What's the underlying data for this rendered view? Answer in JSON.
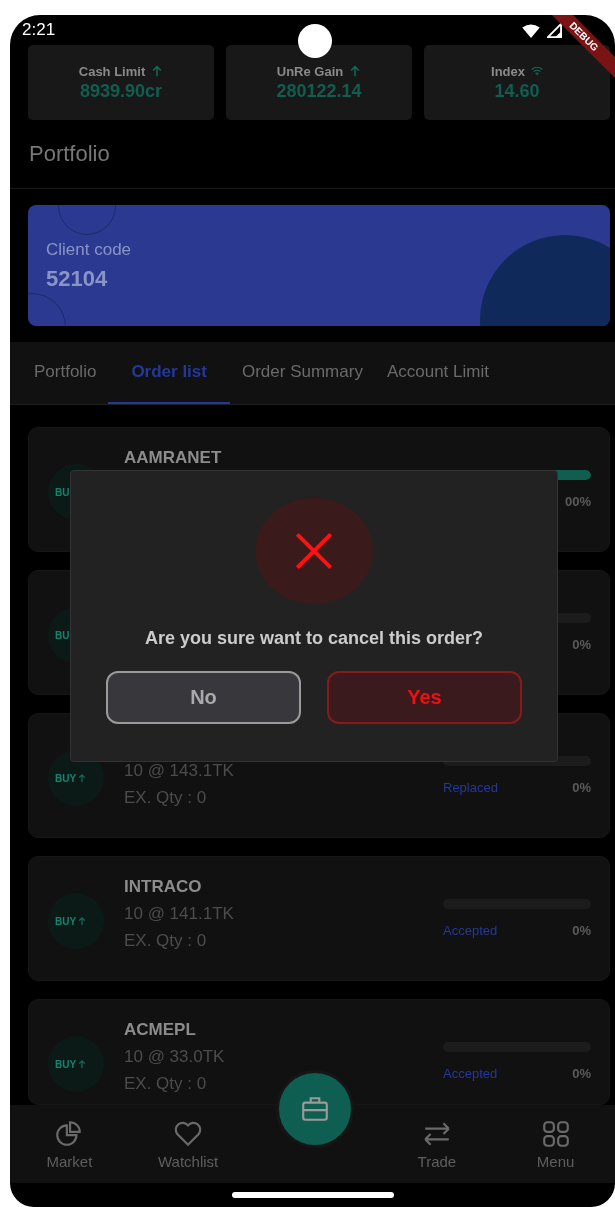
{
  "status_bar": {
    "time": "2:21",
    "ribbon": "DEBUG"
  },
  "stats": [
    {
      "label": "Cash Limit",
      "kind": "arrow",
      "value": "8939.90cr"
    },
    {
      "label": "UnRe Gain",
      "kind": "arrow",
      "value": "280122.14"
    },
    {
      "label": "Index",
      "kind": "wifi",
      "value": "14.60"
    }
  ],
  "title": "Portfolio",
  "client": {
    "label": "Client code",
    "code": "52104"
  },
  "tabs": [
    {
      "label": "Portfolio",
      "selected": false
    },
    {
      "label": "Order list",
      "selected": true
    },
    {
      "label": "Order Summary",
      "selected": false
    },
    {
      "label": "Account Limit",
      "selected": false
    }
  ],
  "orders": [
    {
      "badge": "BU",
      "name": "AAMRANET",
      "level": 1,
      "percent": "00%"
    },
    {
      "badge": "BU",
      "level": 0,
      "percent": "0%"
    },
    {
      "badge": "BUY",
      "arrow": true,
      "price": "10 @ 143.1TK",
      "qty": "EX. Qty : 0",
      "level": 0,
      "status": "Replaced",
      "percent": "0%"
    },
    {
      "badge": "BUY",
      "arrow": true,
      "name": "INTRACO",
      "price": "10 @ 141.1TK",
      "qty": "EX. Qty : 0",
      "level": 0,
      "status": "Accepted",
      "percent": "0%"
    },
    {
      "badge": "BUY",
      "arrow": true,
      "name": "ACMEPL",
      "price": "10 @ 33.0TK",
      "qty": "EX. Qty : 0",
      "level": 0,
      "status": "Accepted",
      "percent": "0%"
    }
  ],
  "dialog": {
    "message": "Are you sure want to cancel this order?",
    "buttons": [
      {
        "label": "No",
        "kind": "neutral"
      },
      {
        "label": "Yes",
        "kind": "danger"
      }
    ]
  },
  "nav": [
    {
      "label": "Market",
      "kind": "pie"
    },
    {
      "label": "Watchlist",
      "kind": "heart"
    },
    {
      "label": "Trade",
      "kind": "arrows"
    },
    {
      "label": "Menu",
      "kind": "grid"
    }
  ]
}
